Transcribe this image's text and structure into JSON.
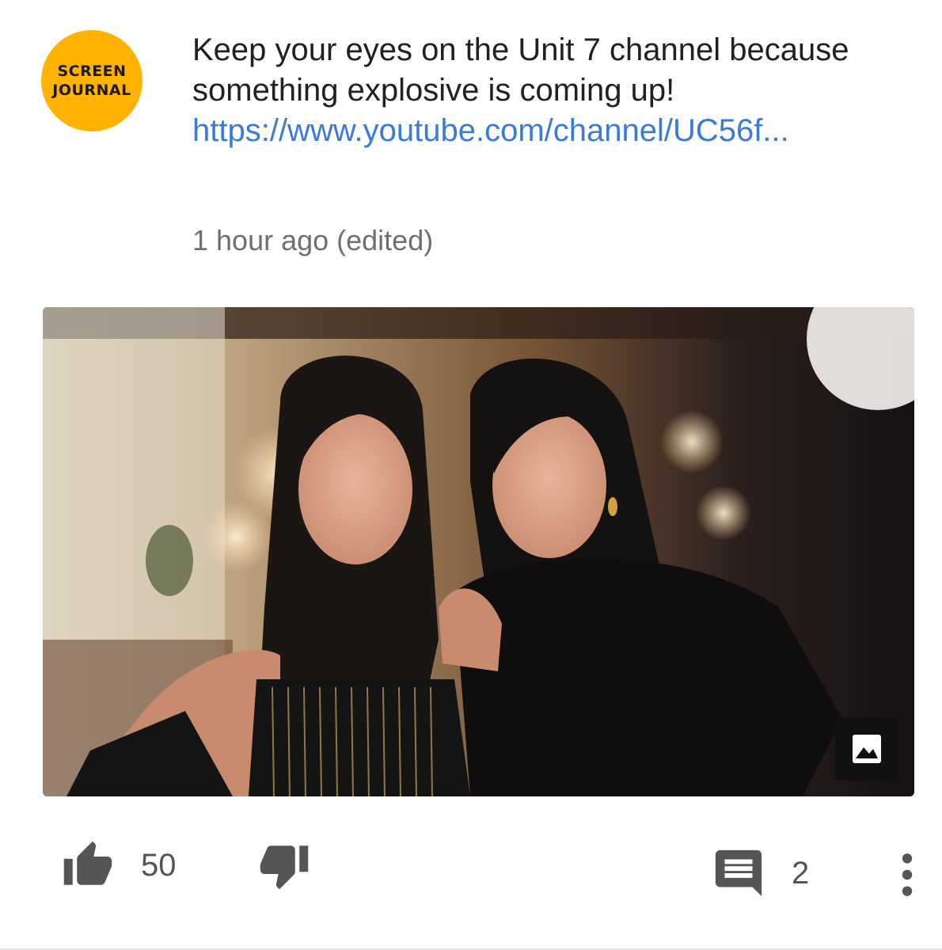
{
  "channel": {
    "avatar_line1": "SCREEN",
    "avatar_line2": "JOURNAL",
    "avatar_color": "#FFB300"
  },
  "post": {
    "text": "Keep your eyes on the Unit 7 channel because something explosive is coming up!",
    "link": "https://www.youtube.com/channel/UC56f...",
    "timestamp": "1 hour ago (edited)",
    "link_color": "#3A7AD9"
  },
  "media": {
    "type": "image",
    "badge_icon": "image-icon"
  },
  "actions": {
    "like_icon": "thumb-up-icon",
    "like_count": "50",
    "dislike_icon": "thumb-down-icon",
    "comment_icon": "comment-icon",
    "comment_count": "2",
    "more_icon": "more-vert-icon"
  }
}
